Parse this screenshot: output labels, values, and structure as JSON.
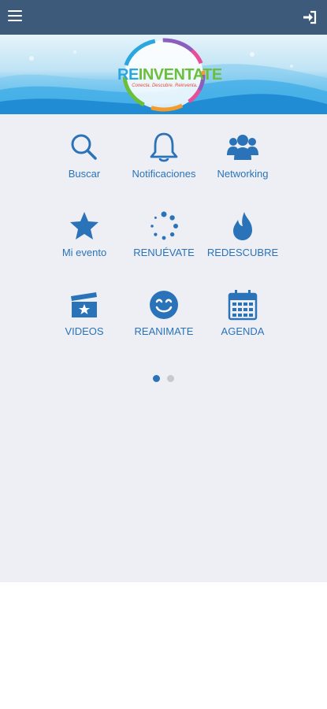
{
  "colors": {
    "topbar": "#3e5a7a",
    "accent": "#2a73b8",
    "content_bg": "#eeeff4"
  },
  "header": {
    "menu_icon": "hamburger-icon",
    "login_icon": "sign-in-icon"
  },
  "banner": {
    "logo_text_prefix": "RE",
    "logo_text_rest": "INVENTATE",
    "logo_tagline": "Conecta. Descubre. Reinventa."
  },
  "grid": {
    "items": [
      {
        "label": "Buscar",
        "icon": "search-icon"
      },
      {
        "label": "Notificaciones",
        "icon": "bell-icon"
      },
      {
        "label": "Networking",
        "icon": "users-icon"
      },
      {
        "label": "Mi evento",
        "icon": "star-icon"
      },
      {
        "label": "RENUÉVATE",
        "icon": "spinner-icon"
      },
      {
        "label": "REDESCUBRE",
        "icon": "fire-icon"
      },
      {
        "label": "VIDEOS",
        "icon": "clapperboard-icon"
      },
      {
        "label": "REANIMATE",
        "icon": "smile-icon"
      },
      {
        "label": "AGENDA",
        "icon": "calendar-icon"
      }
    ]
  },
  "pagination": {
    "pages": 2,
    "current": 1
  }
}
